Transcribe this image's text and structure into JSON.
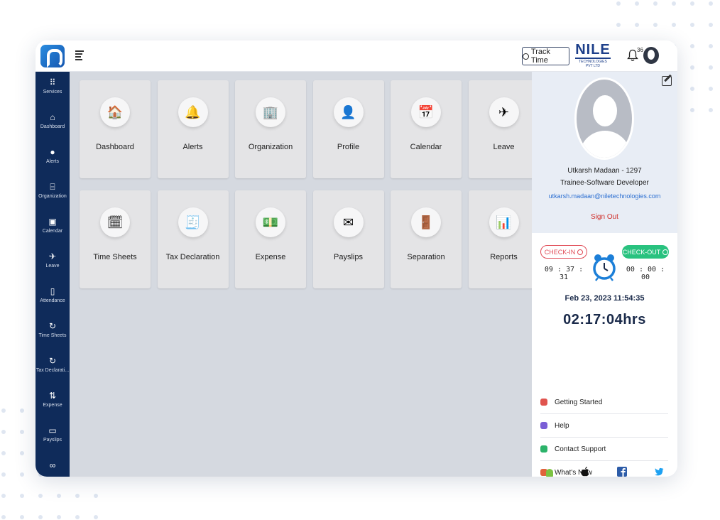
{
  "topbar": {
    "track_time_label": "Track Time",
    "brand_name": "NILE",
    "brand_sub": "TECHNOLOGIES PVT LTD",
    "notification_count": "36"
  },
  "sidebar": {
    "items": [
      {
        "label": "Services",
        "icon": "grid-icon"
      },
      {
        "label": "Dashboard",
        "icon": "home-icon"
      },
      {
        "label": "Alerts",
        "icon": "alert-icon"
      },
      {
        "label": "Organization",
        "icon": "bank-icon"
      },
      {
        "label": "Calendar",
        "icon": "calendar-icon"
      },
      {
        "label": "Leave",
        "icon": "plane-icon"
      },
      {
        "label": "Attendance",
        "icon": "clipboard-icon"
      },
      {
        "label": "Time Sheets",
        "icon": "refresh-icon"
      },
      {
        "label": "Tax Declarati...",
        "icon": "refresh-icon"
      },
      {
        "label": "Expense",
        "icon": "sync-icon"
      },
      {
        "label": "Payslips",
        "icon": "card-icon"
      },
      {
        "label": "",
        "icon": "link-icon"
      }
    ]
  },
  "services": {
    "tiles": [
      {
        "label": "Dashboard",
        "icon": "🏠"
      },
      {
        "label": "Alerts",
        "icon": "🔔"
      },
      {
        "label": "Organization",
        "icon": "🏢"
      },
      {
        "label": "Profile",
        "icon": "👤"
      },
      {
        "label": "Calendar",
        "icon": "📅"
      },
      {
        "label": "Leave",
        "icon": "✈"
      },
      {
        "label": "Time Sheets",
        "icon": "🗓"
      },
      {
        "label": "Tax Declaration",
        "icon": "🧾"
      },
      {
        "label": "Expense",
        "icon": "💵"
      },
      {
        "label": "Payslips",
        "icon": "✉"
      },
      {
        "label": "Separation",
        "icon": "🚪"
      },
      {
        "label": "Reports",
        "icon": "📊"
      }
    ]
  },
  "profile": {
    "name": "Utkarsh Madaan - 1297",
    "role": "Trainee-Software Developer",
    "email": "utkarsh.madaan@niletechnologies.com",
    "sign_out_label": "Sign Out"
  },
  "attendance": {
    "check_in_label": "CHECK-IN",
    "check_out_label": "CHECK-OUT",
    "check_in_time": "09 : 37 : 31",
    "check_out_time": "00 : 00 : 00",
    "date_time": "Feb 23, 2023 11:54:35",
    "hours": "02:17:04hrs"
  },
  "links": [
    {
      "label": "Getting Started",
      "icon": "rocket-icon",
      "color": "#e0544e"
    },
    {
      "label": "Help",
      "icon": "help-icon",
      "color": "#7b5fd6"
    },
    {
      "label": "Contact Support",
      "icon": "support-icon",
      "color": "#2cb36a"
    },
    {
      "label": "What's New",
      "icon": "news-icon",
      "color": "#e0623a"
    }
  ],
  "colors": {
    "sidebar": "#0f2b5a",
    "accent_blue": "#2c6fd1",
    "checkin_red": "#e04a55",
    "checkout_green": "#29c27f"
  }
}
